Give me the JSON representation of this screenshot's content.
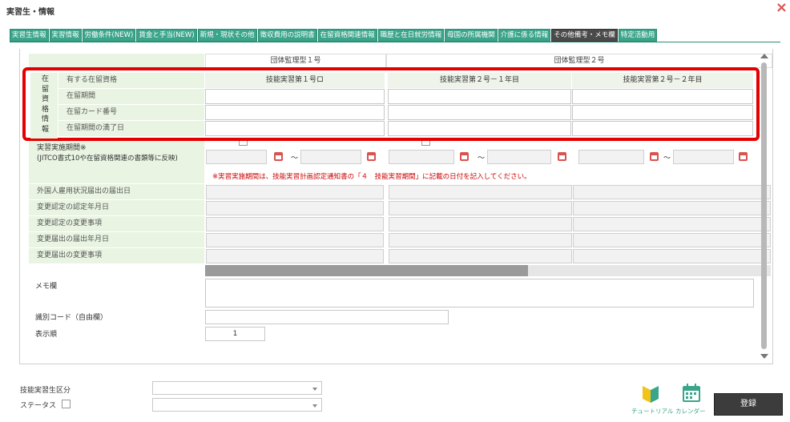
{
  "dialog": {
    "title": "実習生・情報",
    "close": "×"
  },
  "tabs": [
    "実習生情報",
    "実習情報",
    "労働条件(NEW)",
    "賃金と手当(NEW)",
    "新規・現状その他",
    "徴収費用の説明書",
    "在留資格関連情報",
    "職歴と在日就労情報",
    "母国の所属機関",
    "介護に係る情報",
    "その他備考・メモ欄",
    "特定活動用"
  ],
  "headers": {
    "group1": "団体監理型１号",
    "group2": "団体監理型２号"
  },
  "residence": {
    "section_label": [
      "在",
      "留",
      "資",
      "格",
      "情",
      "報"
    ],
    "rows": [
      "有する在留資格",
      "在留期間",
      "在留カード番号",
      "在留期間の満了日"
    ],
    "col1": "技能実習第１号ロ",
    "col2": "技能実習第２号－１年目",
    "col3": "技能実習第２号－２年目"
  },
  "training": {
    "label_line1": "実習実施期間※",
    "label_line2": "(JITCO書式10や在留資格関連の書類等に反映)",
    "tilde": "〜",
    "note": "※実習実施期間は、技能実習計画認定通知書の「４　技能実習期間」に記載の日付を記入してください。"
  },
  "rows": [
    "外国人雇用状況届出の届出日",
    "変更認定の認定年月日",
    "変更認定の変更事項",
    "変更届出の届出年月日",
    "変更届出の変更事項"
  ],
  "memo": {
    "label": "メモ欄"
  },
  "code": {
    "label": "識別コード（自由欄）"
  },
  "order": {
    "label": "表示順",
    "value": "1"
  },
  "bottom": {
    "type_label": "技能実習生区分",
    "status_label": "ステータス",
    "tutorial": "チュートリアル",
    "calendar": "カレンダー",
    "register": "登録"
  },
  "colors": {
    "tab": "#3aa58a",
    "highlight": "#e50000",
    "label_bg": "#e9f4e2"
  }
}
